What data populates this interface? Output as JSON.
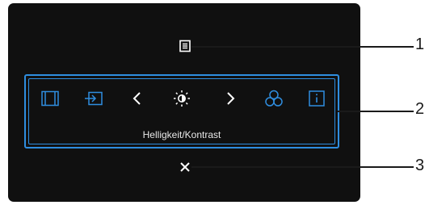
{
  "menu": {
    "icons": [
      "menu-icon",
      "input-source-icon",
      "shortcut-input-icon",
      "chevron-left-icon",
      "brightness-contrast-icon",
      "chevron-right-icon",
      "color-icon",
      "info-icon",
      "close-icon"
    ],
    "label": "Helligkeit/Kontrast"
  },
  "callouts": {
    "one": "1",
    "two": "2",
    "three": "3"
  },
  "colors": {
    "accent": "#2f8ee0",
    "screen": "#101010",
    "icon": "#ffffff"
  }
}
